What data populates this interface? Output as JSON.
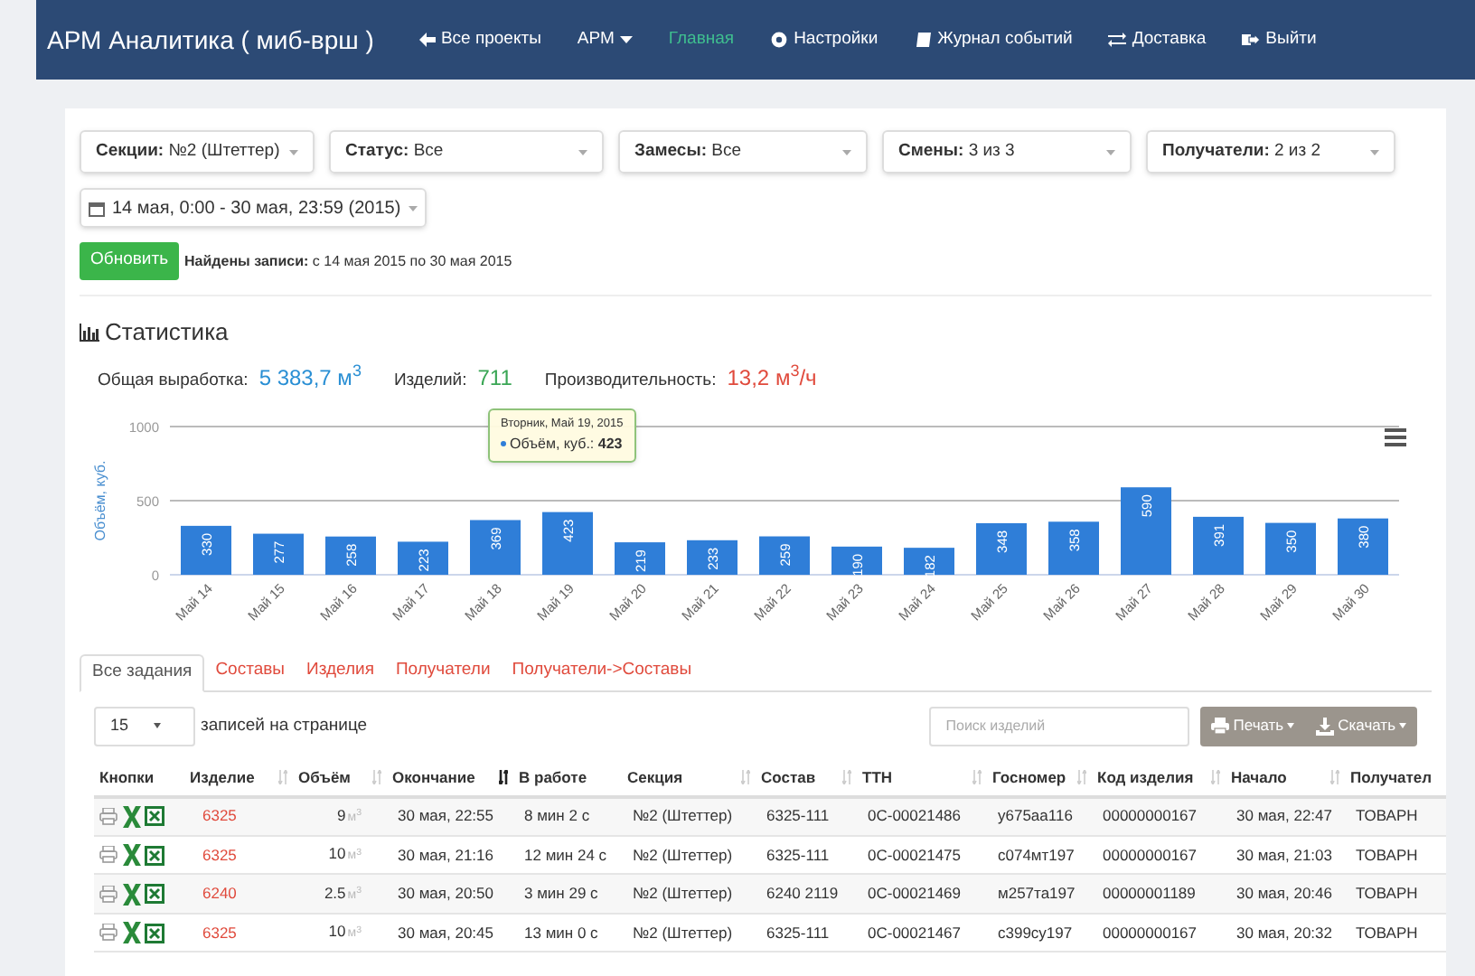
{
  "navbar": {
    "brand": "АРМ Аналитика ( миб-врш )",
    "items": [
      {
        "label": "Все проекты",
        "selected": false
      },
      {
        "label": "АРМ",
        "selected": false
      },
      {
        "label": "Главная",
        "selected": true
      },
      {
        "label": "Настройки",
        "selected": false
      },
      {
        "label": "Журнал событий",
        "selected": false
      },
      {
        "label": "Доставка",
        "selected": false
      },
      {
        "label": "Выйти",
        "selected": false
      }
    ]
  },
  "filters": [
    {
      "label": "Секции:",
      "value": "№2 (Штеттер)"
    },
    {
      "label": "Статус:",
      "value": "Все"
    },
    {
      "label": "Замесы:",
      "value": "Все"
    },
    {
      "label": "Смены:",
      "value": "3 из 3"
    },
    {
      "label": "Получатели:",
      "value": "2 из 2"
    }
  ],
  "date_range": "14 мая, 0:00 - 30 мая, 23:59 (2015)",
  "refresh_button": "Обновить",
  "found": {
    "label": "Найдены записи:",
    "value": "с 14 мая 2015 по 30 мая 2015"
  },
  "statistics": {
    "title": "Статистика",
    "totals": [
      {
        "label": "Общая выработка:",
        "value": "5 383,7 м$^{3}$",
        "color": "#2a8fd4"
      },
      {
        "label": "Изделий:",
        "value": "711",
        "color": "#3aa655"
      },
      {
        "label": "Производительность:",
        "value": "13,2 м$^{3}$/ч",
        "color": "#e04a3c"
      }
    ],
    "chart_data": {
      "type": "bar",
      "ylabel": "Объём, куб.",
      "categories": [
        "Май 14",
        "Май 15",
        "Май 16",
        "Май 17",
        "Май 18",
        "Май 19",
        "Май 20",
        "Май 21",
        "Май 22",
        "Май 23",
        "Май 24",
        "Май 25",
        "Май 26",
        "Май 27",
        "Май 28",
        "Май 29",
        "Май 30"
      ],
      "series": [
        {
          "color": "#2f7ed8",
          "values": [
            330,
            277,
            258,
            223,
            369,
            423,
            219,
            233,
            259,
            190,
            182,
            348,
            358,
            590,
            391,
            350,
            380
          ]
        }
      ],
      "ylim": [
        0,
        1000
      ],
      "yticks": [
        0,
        500,
        1000
      ],
      "data_labels": true
    },
    "tooltip": {
      "title": "Вторник, Май 19, 2015",
      "text": "Объём, куб.: **423**"
    }
  },
  "tabs": [
    {
      "label": "Все задания",
      "selected": true
    },
    {
      "label": "Составы",
      "selected": false
    },
    {
      "label": "Изделия",
      "selected": false
    },
    {
      "label": "Получатели",
      "selected": false
    },
    {
      "label": "Получатели->Составы",
      "selected": false
    }
  ],
  "page_size": {
    "value": "15",
    "label": "записей на странице"
  },
  "search": {
    "placeholder": "Поиск изделий"
  },
  "actions": [
    {
      "label": "Печать"
    },
    {
      "label": "Скачать"
    }
  ],
  "table": {
    "columns": [
      {
        "label": "Кнопки",
        "sortable": false
      },
      {
        "label": "Изделие",
        "sortable": true,
        "sorted": false
      },
      {
        "label": "Объём",
        "sortable": true,
        "sorted": false
      },
      {
        "label": "Окончание",
        "sortable": true,
        "sorted": true
      },
      {
        "label": "В работе",
        "sortable": false
      },
      {
        "label": "Секция",
        "sortable": true,
        "sorted": false
      },
      {
        "label": "Состав",
        "sortable": true,
        "sorted": false
      },
      {
        "label": "ТТН",
        "sortable": true,
        "sorted": false
      },
      {
        "label": "Госномер",
        "sortable": true,
        "sorted": false
      },
      {
        "label": "Код изделия",
        "sortable": true,
        "sorted": false
      },
      {
        "label": "Начало",
        "sortable": true,
        "sorted": false
      },
      {
        "label": "Получател",
        "sortable": false
      }
    ],
    "rows": [
      {
        "product": "6325",
        "volume": "9",
        "unit": "м$^{3}$",
        "end": "30 мая, 22:55",
        "duration": "8 мин 2 с",
        "section": "№2 (Штеттер)",
        "mix": "6325-111",
        "ttn": "0С-00021486",
        "plate": "у675аа116",
        "code": "00000000167",
        "start": "30 мая, 22:47",
        "recipient": "ТОВАРН"
      },
      {
        "product": "6325",
        "volume": "10",
        "unit": "м$^{3}$",
        "end": "30 мая, 21:16",
        "duration": "12 мин 24 с",
        "section": "№2 (Штеттер)",
        "mix": "6325-111",
        "ttn": "0С-00021475",
        "plate": "с074мт197",
        "code": "00000000167",
        "start": "30 мая, 21:03",
        "recipient": "ТОВАРН"
      },
      {
        "product": "6240",
        "volume": "2.5",
        "unit": "м$^{3}$",
        "end": "30 мая, 20:50",
        "duration": "3 мин 29 с",
        "section": "№2 (Штеттер)",
        "mix": "6240 2119",
        "ttn": "0С-00021469",
        "plate": "м257та197",
        "code": "00000001189",
        "start": "30 мая, 20:46",
        "recipient": "ТОВАРН"
      },
      {
        "product": "6325",
        "volume": "10",
        "unit": "м$^{3}$",
        "end": "30 мая, 20:45",
        "duration": "13 мин 0 с",
        "section": "№2 (Штеттер)",
        "mix": "6325-111",
        "ttn": "0С-00021467",
        "plate": "с399су197",
        "code": "00000000167",
        "start": "30 мая, 20:32",
        "recipient": "ТОВАРН"
      }
    ]
  }
}
